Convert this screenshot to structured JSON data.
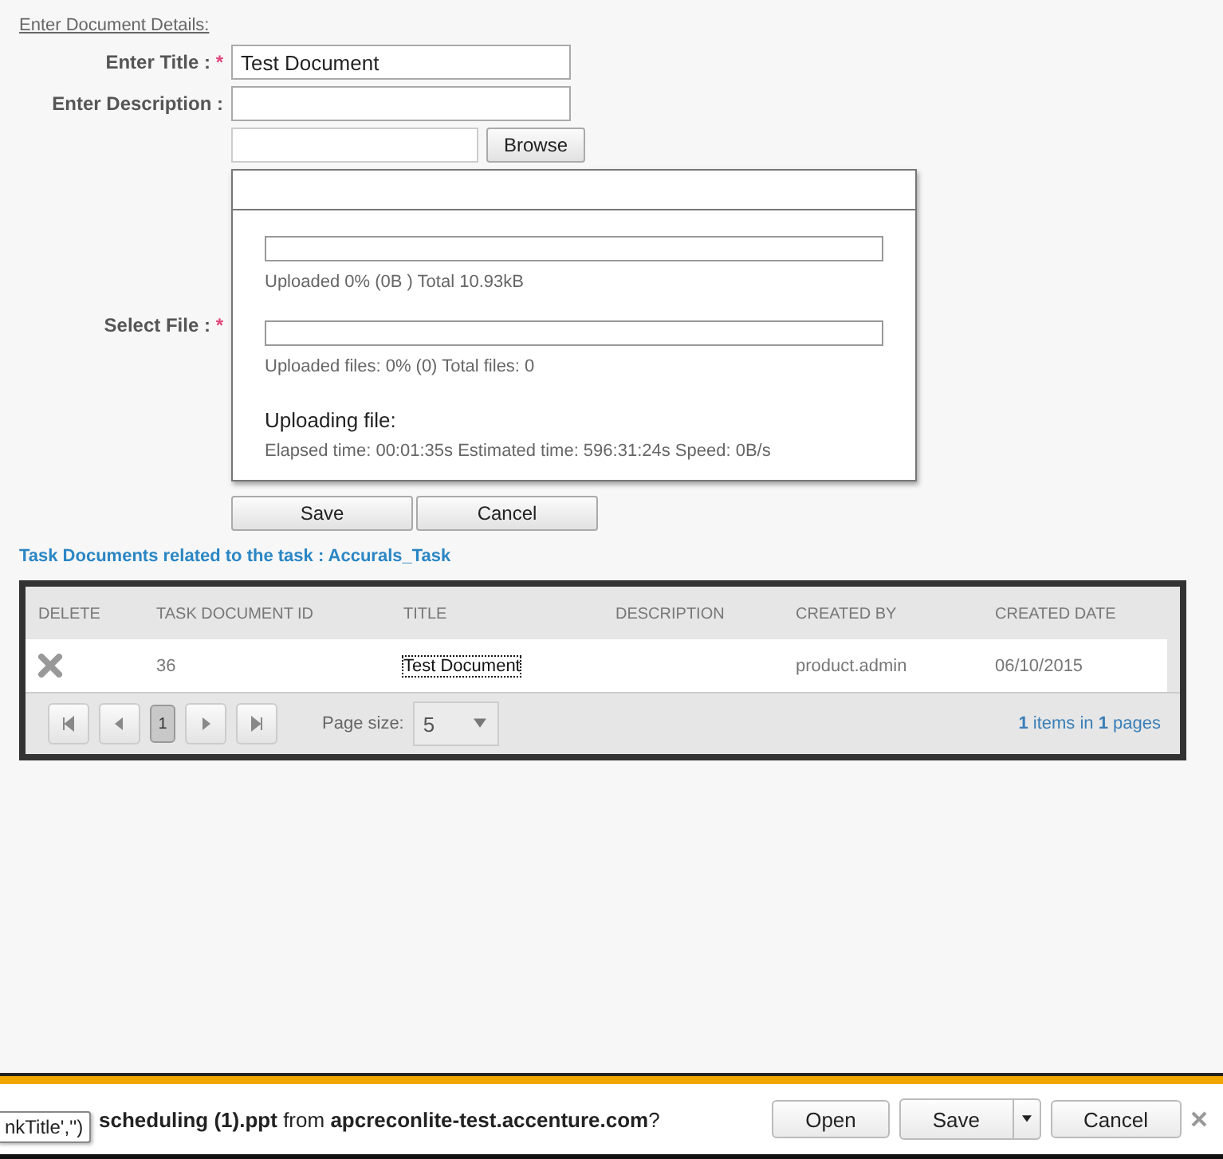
{
  "section_link": "Enter Document Details:",
  "form": {
    "required_mark": "*",
    "title_label": "Enter Title :",
    "title_required": true,
    "title_value": "Test Document",
    "description_label": "Enter Description :",
    "description_required": false,
    "browse_button": "Browse",
    "file_label": "Select File :",
    "file_required": true
  },
  "upload_panel": {
    "bars": [
      {
        "level": 0,
        "text": "Uploaded 0% (0B ) Total 10.93kB"
      },
      {
        "level": 0,
        "text": "Uploaded files: 0% (0) Total files: 0"
      }
    ],
    "heading": "Uploading file:",
    "details": "Elapsed time: 00:01:35s Estimated time: 596:31:24s Speed: 0B/s"
  },
  "actions": [
    "Save",
    "Cancel"
  ],
  "grid_title": "Task Documents related to the task : Accurals_Task",
  "table": {
    "columns": [
      "DELETE",
      "TASK DOCUMENT ID",
      "TITLE",
      "DESCRIPTION",
      "CREATED BY",
      "CREATED DATE"
    ],
    "rows": [
      {
        "id": "36",
        "title": "Test Document",
        "created_by": "product.admin",
        "created_date": "06/10/2015"
      }
    ]
  },
  "pager": {
    "pages": [
      {
        "label": "1",
        "selected": true
      }
    ],
    "page_size_label": "Page size:",
    "page_size": "5",
    "summary": "**1** items in **1** pages"
  },
  "download_bar": {
    "prompt": "**scheduling (1).ppt** from **apcreconlite-test.accenture.com**?",
    "buttons": [
      "Open",
      "Save",
      "Cancel"
    ],
    "tooltip": "nkTitle','')"
  }
}
